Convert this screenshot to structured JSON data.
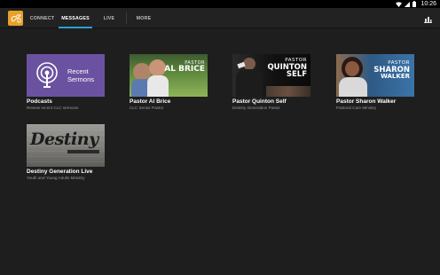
{
  "status_bar": {
    "time": "10:26"
  },
  "app": {
    "accent": "#2a9fd0",
    "logo_color": "#e8a12a"
  },
  "tabs": [
    {
      "label": "CONNECT",
      "active": false
    },
    {
      "label": "MESSAGES",
      "active": true
    },
    {
      "label": "LIVE",
      "active": false
    },
    {
      "label": "MORE",
      "active": false
    }
  ],
  "cards": [
    {
      "title": "Podcasts",
      "subtitle": "Review recent CLC sermons",
      "thumb_text": [
        "Recent",
        "Sermons"
      ],
      "icon": "podcast-broadcast-icon"
    },
    {
      "title": "Pastor Al Brice",
      "subtitle": "CLC Senior Pastor",
      "thumb_text": [
        "PASTOR",
        "AL BRICE"
      ]
    },
    {
      "title": "Pastor Quinton Self",
      "subtitle": "Destiny Generation Pastor",
      "thumb_text": [
        "PASTOR",
        "QUINTON",
        "SELF"
      ]
    },
    {
      "title": "Pastor Sharon Walker",
      "subtitle": "Pastoral Care Ministry",
      "thumb_text": [
        "PASTOR",
        "SHARON",
        "WALKER"
      ]
    },
    {
      "title": "Destiny Generation Live",
      "subtitle": "Youth and Young Adults Ministry",
      "thumb_text": [
        "Destiny"
      ]
    }
  ]
}
